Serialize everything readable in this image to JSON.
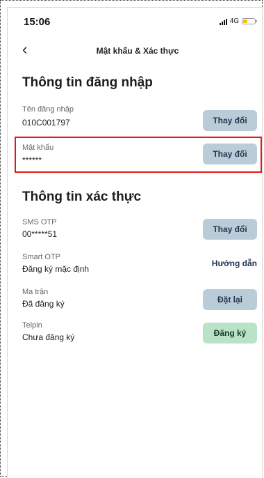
{
  "status_bar": {
    "time": "15:06",
    "network": "4G"
  },
  "nav": {
    "back_icon": "chevron-left-icon",
    "back_glyph": "‹",
    "title": "Mật khẩu & Xác thực"
  },
  "login_section": {
    "title": "Thông tin đăng nhập",
    "username": {
      "label": "Tên đăng nhập",
      "value": "010C001797",
      "button": "Thay đổi"
    },
    "password": {
      "label": "Mật khẩu",
      "value": "******",
      "button": "Thay đổi"
    }
  },
  "auth_section": {
    "title": "Thông tin xác thực",
    "sms_otp": {
      "label": "SMS OTP",
      "value": "00*****51",
      "button": "Thay đổi"
    },
    "smart_otp": {
      "label": "Smart OTP",
      "value": "Đăng ký mặc định",
      "link": "Hướng dẫn"
    },
    "matrix": {
      "label": "Ma trận",
      "value": "Đã đăng ký",
      "button": "Đặt lại"
    },
    "telpin": {
      "label": "Telpin",
      "value": "Chưa đăng ký",
      "button": "Đăng ký"
    }
  },
  "colors": {
    "button_blue": "#b9ccd8",
    "button_green": "#b9e3c7",
    "highlight_red": "#e01a1a"
  }
}
